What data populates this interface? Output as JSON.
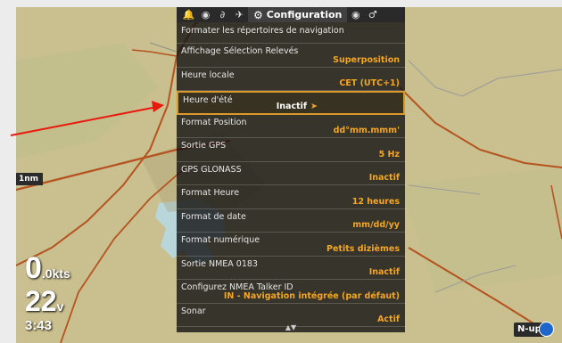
{
  "map": {
    "scale": "1nm",
    "speed_value": "0",
    "speed_unit": ".0kts",
    "voltage_value": "22",
    "voltage_unit": "v",
    "time": "3:43",
    "orientation": "N-up"
  },
  "menu": {
    "tabs": [
      {
        "icon": "bell-icon",
        "glyph": "🔔"
      },
      {
        "icon": "compass-icon",
        "glyph": "◉"
      },
      {
        "icon": "fish-chart-icon",
        "glyph": "∂"
      },
      {
        "icon": "radar-icon",
        "glyph": "✈"
      }
    ],
    "active_tab": "Configuration",
    "tabs_right": [
      {
        "icon": "eye-icon",
        "glyph": "◉"
      },
      {
        "icon": "settings-extra-icon",
        "glyph": "♂"
      }
    ],
    "items": [
      {
        "label": "Formater les répertoires de navigation",
        "value": ""
      },
      {
        "label": "Affichage Sélection Relevés",
        "value": "Superposition"
      },
      {
        "label": "Heure locale",
        "value": "CET (UTC+1)"
      },
      {
        "label": "Heure d'été",
        "value": "Inactif",
        "selected": true
      },
      {
        "label": "Format Position",
        "value": "dd°mm.mmm'"
      },
      {
        "label": "Sortie GPS",
        "value": "5 Hz"
      },
      {
        "label": "GPS GLONASS",
        "value": "Inactif"
      },
      {
        "label": "Format Heure",
        "value": "12 heures"
      },
      {
        "label": "Format de date",
        "value": "mm/dd/yy"
      },
      {
        "label": "Format numérique",
        "value": "Petits dizièmes"
      },
      {
        "label": "Sortie NMEA 0183",
        "value": "Inactif"
      },
      {
        "label": "Configurez NMEA Talker ID",
        "value": "IN - Navigation intégrée (par défaut)"
      },
      {
        "label": "Sonar",
        "value": "Actif"
      }
    ]
  },
  "colors": {
    "accent": "#f5a623",
    "highlight": "#d99a2b",
    "map_land": "#c9bf8f",
    "water": "#b8d4d8",
    "road": "#b5531f"
  }
}
